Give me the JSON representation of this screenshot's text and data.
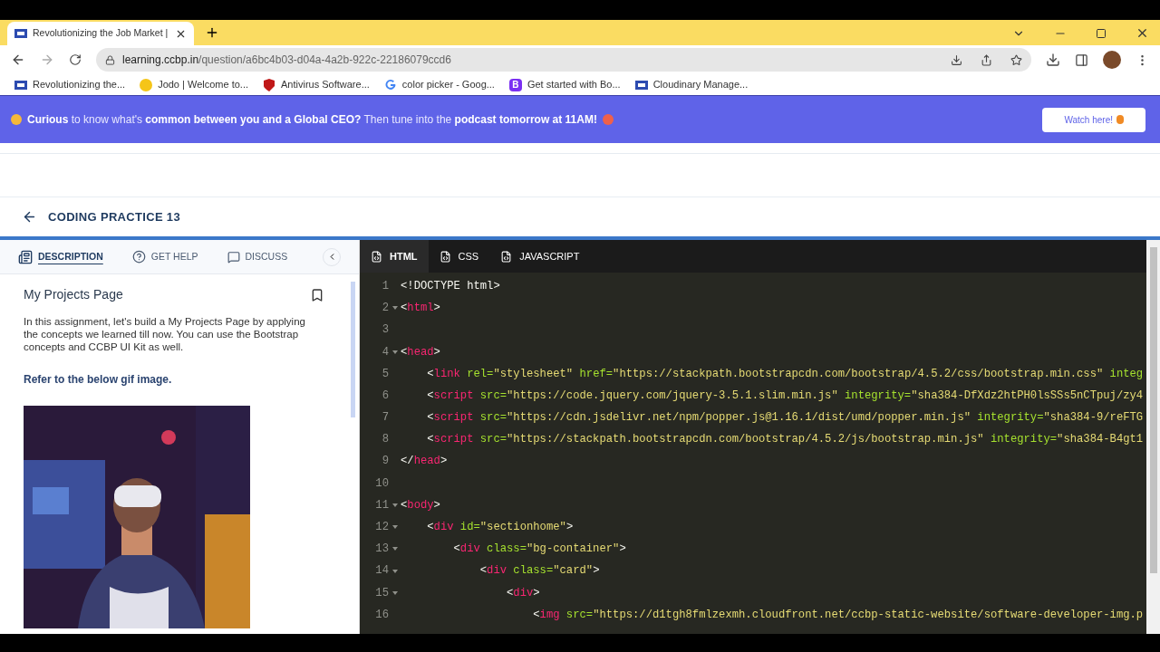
{
  "browser": {
    "tab_title": "Revolutionizing the Job Market |",
    "url_host": "learning.ccbp.in",
    "url_path": "/question/a6bc4b03-d04a-4a2b-922c-22186079ccd6",
    "bookmarks": [
      {
        "label": "Revolutionizing the...",
        "kind": "site"
      },
      {
        "label": "Jodo | Welcome to...",
        "kind": "dot"
      },
      {
        "label": "Antivirus Software...",
        "kind": "shield"
      },
      {
        "label": "color picker - Goog...",
        "kind": "google"
      },
      {
        "label": "Get started with Bo...",
        "kind": "letter",
        "letter": "B"
      },
      {
        "label": "Cloudinary Manage...",
        "kind": "site"
      }
    ]
  },
  "banner": {
    "text": "**Curious** to know what's **common between you and a Global CEO?** Then tune into the **podcast tomorrow at 11AM!**",
    "button": "Watch here!"
  },
  "header": {
    "title": "CODING PRACTICE 13"
  },
  "left_tabs": [
    {
      "label": "DESCRIPTION",
      "kind": "doc",
      "selected": true
    },
    {
      "label": "GET HELP",
      "kind": "help",
      "selected": false
    },
    {
      "label": "DISCUSS",
      "kind": "chat",
      "selected": false
    }
  ],
  "description": {
    "title": "My Projects Page",
    "body": "In this assignment, let's build a My Projects Page by applying the concepts we learned till now. You can use the Bootstrap concepts and CCBP UI Kit as well.",
    "note": "Refer to the below gif image."
  },
  "editor_tabs": [
    {
      "label": "HTML",
      "selected": true
    },
    {
      "label": "CSS",
      "selected": false
    },
    {
      "label": "JAVASCRIPT",
      "selected": false
    }
  ],
  "code": [
    {
      "number": "1",
      "fold": false,
      "tokens": [
        {
          "kind": "punct",
          "text": "<!DOCTYPE html>"
        }
      ]
    },
    {
      "number": "2",
      "fold": true,
      "tokens": [
        {
          "kind": "punct",
          "text": "<"
        },
        {
          "kind": "tag",
          "text": "html"
        },
        {
          "kind": "punct",
          "text": ">"
        }
      ]
    },
    {
      "number": "3",
      "fold": false
    },
    {
      "number": "4",
      "fold": true,
      "tokens": [
        {
          "kind": "punct",
          "text": "<"
        },
        {
          "kind": "tag",
          "text": "head"
        },
        {
          "kind": "punct",
          "text": ">"
        }
      ]
    },
    {
      "number": "5",
      "fold": false,
      "tokens": [
        {
          "kind": "punct",
          "text": "    <"
        },
        {
          "kind": "tag",
          "text": "link"
        },
        {
          "kind": "attr",
          "text": " rel="
        },
        {
          "kind": "str",
          "text": "\"stylesheet\""
        },
        {
          "kind": "attr",
          "text": " href="
        },
        {
          "kind": "str",
          "text": "\"https://stackpath.bootstrapcdn.com/bootstrap/4.5.2/css/bootstrap.min.css\""
        },
        {
          "kind": "attr",
          "text": " integ"
        }
      ]
    },
    {
      "number": "6",
      "fold": false,
      "tokens": [
        {
          "kind": "punct",
          "text": "    <"
        },
        {
          "kind": "tag",
          "text": "script"
        },
        {
          "kind": "attr",
          "text": " src="
        },
        {
          "kind": "str",
          "text": "\"https://code.jquery.com/jquery-3.5.1.slim.min.js\""
        },
        {
          "kind": "attr",
          "text": " integrity="
        },
        {
          "kind": "str",
          "text": "\"sha384-DfXdz2htPH0lsSSs5nCTpuj/zy4"
        }
      ]
    },
    {
      "number": "7",
      "fold": false,
      "tokens": [
        {
          "kind": "punct",
          "text": "    <"
        },
        {
          "kind": "tag",
          "text": "script"
        },
        {
          "kind": "attr",
          "text": " src="
        },
        {
          "kind": "str",
          "text": "\"https://cdn.jsdelivr.net/npm/popper.js@1.16.1/dist/umd/popper.min.js\""
        },
        {
          "kind": "attr",
          "text": " integrity="
        },
        {
          "kind": "str",
          "text": "\"sha384-9/reFTG"
        }
      ]
    },
    {
      "number": "8",
      "fold": false,
      "tokens": [
        {
          "kind": "punct",
          "text": "    <"
        },
        {
          "kind": "tag",
          "text": "script"
        },
        {
          "kind": "attr",
          "text": " src="
        },
        {
          "kind": "str",
          "text": "\"https://stackpath.bootstrapcdn.com/bootstrap/4.5.2/js/bootstrap.min.js\""
        },
        {
          "kind": "attr",
          "text": " integrity="
        },
        {
          "kind": "str",
          "text": "\"sha384-B4gt1"
        }
      ]
    },
    {
      "number": "9",
      "fold": false,
      "tokens": [
        {
          "kind": "punct",
          "text": "</"
        },
        {
          "kind": "tag",
          "text": "head"
        },
        {
          "kind": "punct",
          "text": ">"
        }
      ]
    },
    {
      "number": "10",
      "fold": false
    },
    {
      "number": "11",
      "fold": true,
      "tokens": [
        {
          "kind": "punct",
          "text": "<"
        },
        {
          "kind": "tag",
          "text": "body"
        },
        {
          "kind": "punct",
          "text": ">"
        }
      ]
    },
    {
      "number": "12",
      "fold": true,
      "tokens": [
        {
          "kind": "punct",
          "text": "    <"
        },
        {
          "kind": "tag",
          "text": "div"
        },
        {
          "kind": "attr",
          "text": " id="
        },
        {
          "kind": "str",
          "text": "\"sectionhome\""
        },
        {
          "kind": "punct",
          "text": ">"
        }
      ]
    },
    {
      "number": "13",
      "fold": true,
      "tokens": [
        {
          "kind": "punct",
          "text": "        <"
        },
        {
          "kind": "tag",
          "text": "div"
        },
        {
          "kind": "attr",
          "text": " class="
        },
        {
          "kind": "str",
          "text": "\"bg-container\""
        },
        {
          "kind": "punct",
          "text": ">"
        }
      ]
    },
    {
      "number": "14",
      "fold": true,
      "tokens": [
        {
          "kind": "punct",
          "text": "            <"
        },
        {
          "kind": "tag",
          "text": "div"
        },
        {
          "kind": "attr",
          "text": " class="
        },
        {
          "kind": "str",
          "text": "\"card\""
        },
        {
          "kind": "punct",
          "text": ">"
        }
      ]
    },
    {
      "number": "15",
      "fold": true,
      "tokens": [
        {
          "kind": "punct",
          "text": "                <"
        },
        {
          "kind": "tag",
          "text": "div"
        },
        {
          "kind": "punct",
          "text": ">"
        }
      ]
    },
    {
      "number": "16",
      "fold": false,
      "tokens": [
        {
          "kind": "punct",
          "text": "                    <"
        },
        {
          "kind": "tag",
          "text": "img"
        },
        {
          "kind": "attr",
          "text": " src="
        },
        {
          "kind": "str",
          "text": "\"https://d1tgh8fmlzexmh.cloudfront.net/ccbp-static-website/software-developer-img.p"
        }
      ]
    }
  ]
}
